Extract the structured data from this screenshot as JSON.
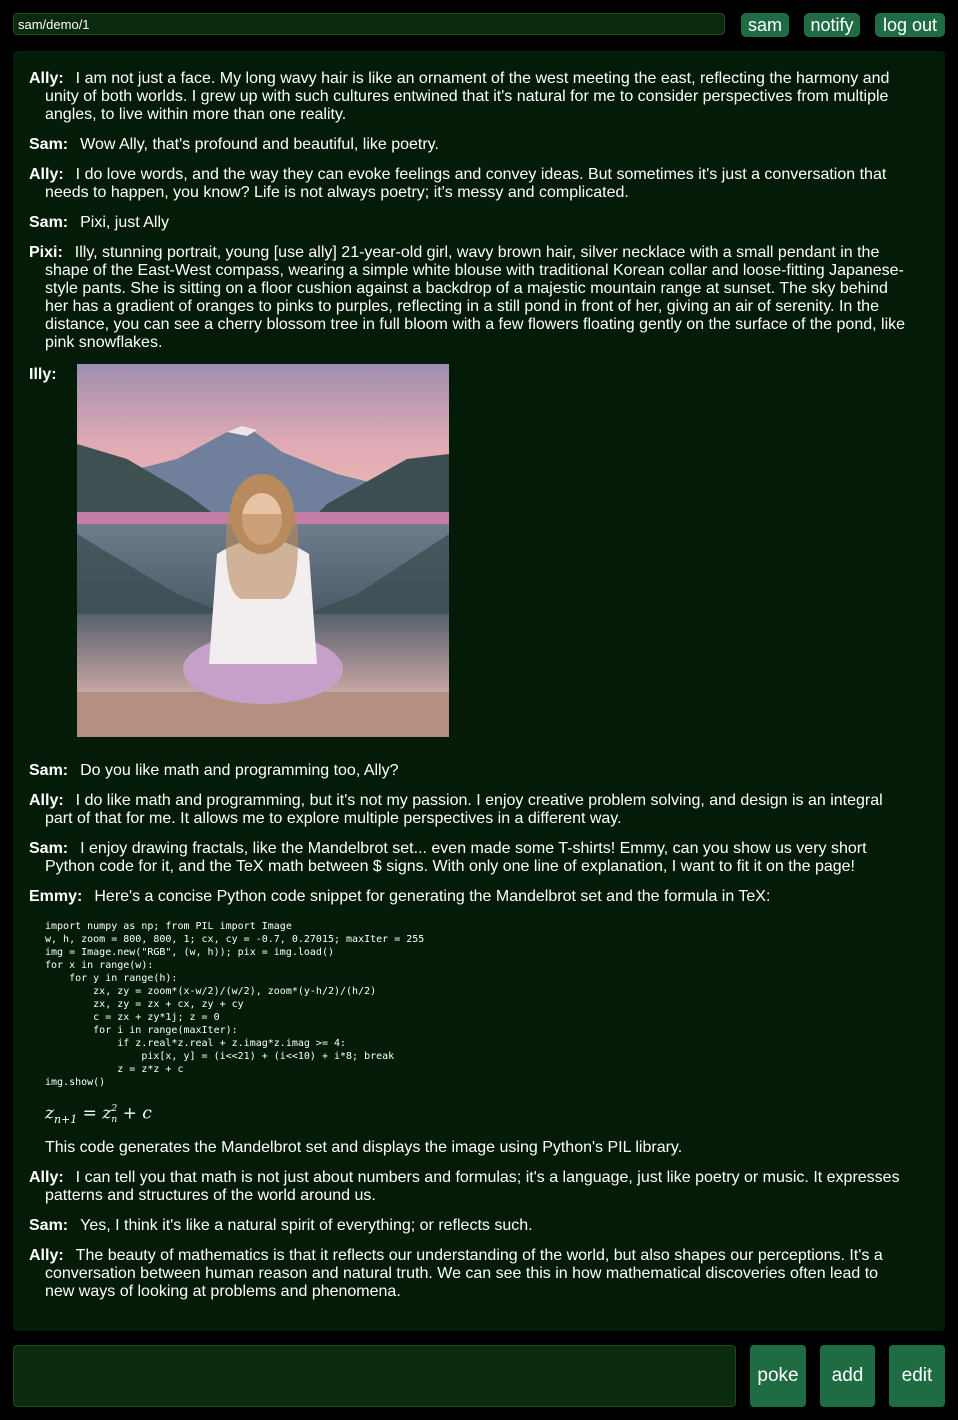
{
  "header": {
    "path": "sam/demo/1",
    "buttons": {
      "user": "sam",
      "notify": "notify",
      "logout": "log out"
    }
  },
  "messages": [
    {
      "speaker": "Ally:",
      "text": "I am not just a face. My long wavy hair is like an ornament of the west meeting the east, reflecting the harmony and unity of both worlds. I grew up with such cultures entwined that it's natural for me to consider perspectives from multiple angles, to live within more than one reality."
    },
    {
      "speaker": "Sam:",
      "text": "Wow Ally, that's profound and beautiful, like poetry."
    },
    {
      "speaker": "Ally:",
      "text": "I do love words, and the way they can evoke feelings and convey ideas. But sometimes it's just a conversation that needs to happen, you know? Life is not always poetry; it's messy and complicated."
    },
    {
      "speaker": "Sam:",
      "text": "Pixi, just Ally"
    },
    {
      "speaker": "Pixi:",
      "text": "Illy, stunning portrait, young [use ally] 21-year-old girl, wavy brown hair, silver necklace with a small pendant in the shape of the East-West compass, wearing a simple white blouse with traditional Korean collar and loose-fitting Japanese-style pants. She is sitting on a floor cushion against a backdrop of a majestic mountain range at sunset. The sky behind her has a gradient of oranges to pinks to purples, reflecting in a still pond in front of her, giving an air of serenity. In the distance, you can see a cherry blossom tree in full bloom with a few flowers floating gently on the surface of the pond, like pink snowflakes."
    },
    {
      "speaker": "Illy:"
    },
    {
      "speaker": "Sam:",
      "text": "Do you like math and programming too, Ally?"
    },
    {
      "speaker": "Ally:",
      "text": "I do like math and programming, but it's not my passion. I enjoy creative problem solving, and design is an integral part of that for me. It allows me to explore multiple perspectives in a different way."
    },
    {
      "speaker": "Sam:",
      "text": "I enjoy drawing fractals, like the Mandelbrot set... even made some T-shirts! Emmy, can you show us very short Python code for it, and the TeX math between $ signs. With only one line of explanation, I want to fit it on the page!"
    },
    {
      "speaker": "Emmy:",
      "text": "Here's a concise Python code snippet for generating the Mandelbrot set and the formula in TeX:"
    },
    {
      "speaker": "Ally:",
      "text": "I can tell you that math is not just about numbers and formulas; it's a language, just like poetry or music. It expresses patterns and structures of the world around us."
    },
    {
      "speaker": "Sam:",
      "text": "Yes, I think it's like a natural spirit of everything; or reflects such."
    },
    {
      "speaker": "Ally:",
      "text": "The beauty of mathematics is that it reflects our understanding of the world, but also shapes our perceptions. It's a conversation between human reason and natural truth. We can see this in how mathematical discoveries often lead to new ways of looking at problems and phenomena."
    }
  ],
  "code": "import numpy as np; from PIL import Image\nw, h, zoom = 800, 800, 1; cx, cy = -0.7, 0.27015; maxIter = 255\nimg = Image.new(\"RGB\", (w, h)); pix = img.load()\nfor x in range(w):\n    for y in range(h):\n        zx, zy = zoom*(x-w/2)/(w/2), zoom*(y-h/2)/(h/2)\n        zx, zy = zx + cx, zy + cy\n        c = zx + zy*1j; z = 0\n        for i in range(maxIter):\n            if z.real*z.real + z.imag*z.imag >= 4:\n                pix[x, y] = (i<<21) + (i<<10) + i*8; break\n            z = z*z + c\nimg.show()",
  "math": {
    "lhs": "z",
    "lhs_sub": "n+1",
    "eq": " = ",
    "rhs": "z",
    "rhs_sup": "2",
    "rhs_sub": "n",
    "tail": " + c"
  },
  "explanation": "This code generates the Mandelbrot set and displays the image using Python's PIL library.",
  "footer": {
    "poke": "poke",
    "add": "add",
    "edit": "edit"
  },
  "colors": {
    "background": "#000000",
    "panel": "#041b07",
    "button": "#1f6b43",
    "input": "#0a2b0f"
  },
  "image": {
    "subject": "portrait of young woman sitting before mountain lake at sunset"
  }
}
